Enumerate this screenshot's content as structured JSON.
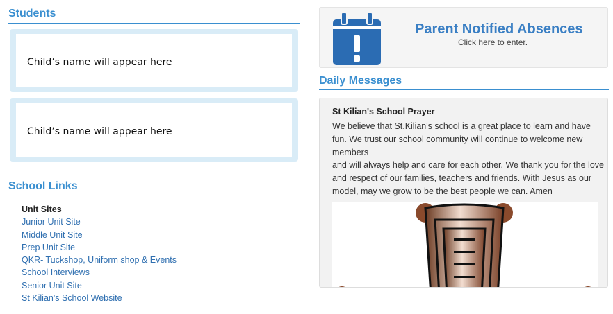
{
  "students": {
    "title": "Students",
    "cards": [
      {
        "name": "Child’s name will appear here"
      },
      {
        "name": "Child’s name will appear here"
      }
    ]
  },
  "school_links": {
    "title": "School Links",
    "heading": "Unit Sites",
    "items": [
      "Junior Unit Site",
      "Middle Unit Site",
      "Prep Unit Site",
      "QKR- Tuckshop, Uniform shop & Events",
      "School Interviews",
      "Senior Unit Site",
      "St Kilian's School Website"
    ]
  },
  "absences": {
    "title": "Parent Notified Absences",
    "subtitle": "Click here to enter.",
    "icon": "calendar-alert-icon"
  },
  "daily_messages": {
    "title": "Daily Messages",
    "message_title": "St Kilian's School Prayer",
    "message_body": "We believe that St.Kilian's school is a great place to learn and have fun. We trust our school community will continue to welcome new members\nand will always help and care for each other. We thank you for the love and respect of our families, teachers and friends. With Jesus as our model, may we grow to be the best people we can. Amen",
    "image_icon": "chair-illustration"
  },
  "colors": {
    "accent": "#3a8fd0",
    "link": "#2f6fb0",
    "card_bg": "#d9ecf7",
    "calendar": "#2b6cb3"
  }
}
